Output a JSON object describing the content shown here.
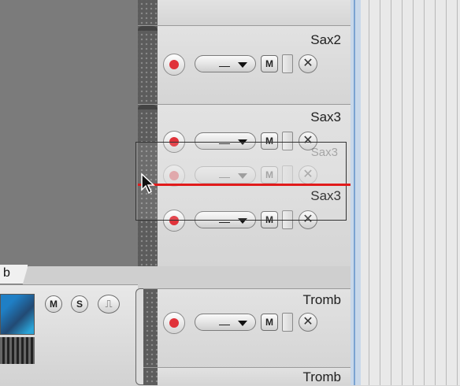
{
  "tracks": [
    {
      "name": "Sax2",
      "mute_label": "M",
      "routing": "—"
    },
    {
      "name": "Sax3",
      "mute_label": "M",
      "routing": "—"
    },
    {
      "name": "Sax3",
      "mute_label": "M",
      "routing": "—"
    },
    {
      "name": "Tromb",
      "mute_label": "M",
      "routing": "—"
    },
    {
      "name": "Tromb"
    }
  ],
  "drag_ghost": {
    "name": "Sax3",
    "mute_label": "M",
    "routing": "—"
  },
  "group_tab": {
    "label": "b"
  },
  "group_controls": {
    "mute": "M",
    "solo": "S",
    "wave_glyph": "⎍"
  },
  "track_close_glyph": "✕",
  "colors": {
    "record": "#e0323a",
    "insert_line": "#e11b1b",
    "playhead": "#7aa3d1"
  }
}
